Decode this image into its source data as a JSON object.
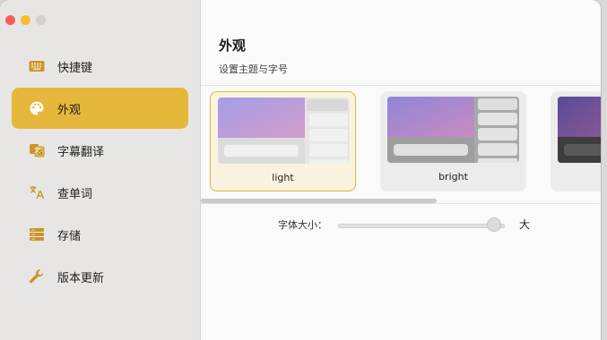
{
  "sidebar": {
    "items": [
      {
        "label": "快捷键",
        "icon": "keyboard-icon",
        "active": false
      },
      {
        "label": "外观",
        "icon": "palette-icon",
        "active": true
      },
      {
        "label": "字幕翻译",
        "icon": "translate-subtitle-icon",
        "active": false
      },
      {
        "label": "查单词",
        "icon": "dictionary-icon",
        "active": false
      },
      {
        "label": "存储",
        "icon": "storage-icon",
        "active": false
      },
      {
        "label": "版本更新",
        "icon": "wrench-icon",
        "active": false
      }
    ]
  },
  "main": {
    "title": "外观",
    "subtitle": "设置主题与字号",
    "themes": [
      {
        "label": "light",
        "selected": true
      },
      {
        "label": "bright",
        "selected": false
      },
      {
        "label": "",
        "selected": false
      }
    ],
    "font_size": {
      "label": "字体大小：",
      "max_label": "大",
      "level": 0.97
    }
  },
  "colors": {
    "accent": "#e5b83b",
    "icon": "#c9962a"
  }
}
